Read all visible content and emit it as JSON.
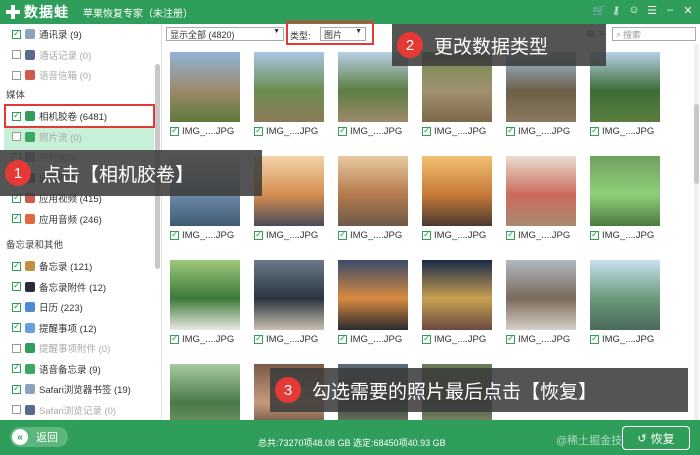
{
  "app": {
    "logo_text": "数据蛙",
    "title": "苹果恢复专家（未注册）",
    "titlebar_icons": [
      "cart-icon",
      "key-icon",
      "chat-icon",
      "menu-icon",
      "minimize-icon",
      "close-icon"
    ]
  },
  "sidebar": {
    "top_items": [
      {
        "label": "通讯录 (9)",
        "checked": true,
        "dim": false
      },
      {
        "label": "通话记录 (0)",
        "checked": false,
        "dim": true
      },
      {
        "label": "语音信箱 (0)",
        "checked": false,
        "dim": true
      }
    ],
    "media_title": "媒体",
    "media_items": [
      {
        "label": "相机胶卷 (6481)",
        "checked": true,
        "active": true,
        "dim": false
      },
      {
        "label": "照片流 (0)",
        "checked": false,
        "dim": true
      },
      {
        "label": "照片图库",
        "checked": false,
        "dim": true
      },
      {
        "label": "应用照片",
        "checked": true,
        "dim": false
      },
      {
        "label": "应用视频 (415)",
        "checked": true,
        "dim": false
      },
      {
        "label": "应用音频 (246)",
        "checked": true,
        "dim": false
      }
    ],
    "memo_title": "备忘录和其他",
    "memo_items": [
      {
        "label": "备忘录 (121)",
        "checked": true,
        "dim": false
      },
      {
        "label": "备忘录附件 (12)",
        "checked": true,
        "dim": false
      },
      {
        "label": "日历 (223)",
        "checked": true,
        "dim": false
      },
      {
        "label": "提醒事项 (12)",
        "checked": true,
        "dim": false
      },
      {
        "label": "提醒事项附件 (0)",
        "checked": false,
        "dim": true
      },
      {
        "label": "语音备忘录 (9)",
        "checked": true,
        "dim": false
      },
      {
        "label": "Safari浏览器书签 (19)",
        "checked": true,
        "dim": false
      },
      {
        "label": "Safari浏览记录 (0)",
        "checked": false,
        "dim": true
      }
    ]
  },
  "toolbar": {
    "filter_value": "显示全部 (4820)",
    "type_label": "类型:",
    "type_value": "图片",
    "search_placeholder": "搜索"
  },
  "grid": {
    "caption": "IMG_....JPG",
    "tiles": [
      {
        "colors": [
          "#8fb3d8",
          "#9b8a6a",
          "#5f7a3c"
        ]
      },
      {
        "colors": [
          "#a9c6e6",
          "#6b8e4e",
          "#8c7a5a"
        ]
      },
      {
        "colors": [
          "#b7cfe4",
          "#5d7d42",
          "#9c8a6a"
        ]
      },
      {
        "colors": [
          "#6f8d4f",
          "#a09070",
          "#7f6a4a"
        ]
      },
      {
        "colors": [
          "#9ec0dc",
          "#6d6048",
          "#8a7860"
        ]
      },
      {
        "colors": [
          "#b5d0e8",
          "#3d6e36",
          "#5b7e40"
        ]
      },
      {
        "colors": [
          "#dfe6ee",
          "#6e8ca8",
          "#3f5a74"
        ]
      },
      {
        "colors": [
          "#f3d2a8",
          "#d58e50",
          "#4a4a58"
        ]
      },
      {
        "colors": [
          "#e8c9a0",
          "#b47a4e",
          "#6d5a4a"
        ]
      },
      {
        "colors": [
          "#f0c070",
          "#c87a38",
          "#4a3a30"
        ]
      },
      {
        "colors": [
          "#e9ddd0",
          "#cc6a5a",
          "#a88a70"
        ]
      },
      {
        "colors": [
          "#6fa060",
          "#8ecf7a",
          "#4b7a40"
        ]
      },
      {
        "colors": [
          "#9ec87a",
          "#3b7a3a",
          "#e8e8e0"
        ]
      },
      {
        "colors": [
          "#6a7a8a",
          "#2a3440",
          "#c8c0b0"
        ]
      },
      {
        "colors": [
          "#3a4a6a",
          "#d88a40",
          "#2a2a30"
        ]
      },
      {
        "colors": [
          "#1a2a4a",
          "#c8a050",
          "#6a4a40"
        ]
      },
      {
        "colors": [
          "#b0b8c0",
          "#7a6a5a",
          "#d8d0c8"
        ]
      },
      {
        "colors": [
          "#c8e0f0",
          "#6a9a7a",
          "#4a6a5a"
        ]
      },
      {
        "colors": [
          "#a8c8a0",
          "#4a7a4a",
          "#7a9a6a"
        ]
      },
      {
        "colors": [
          "#7a5a4a",
          "#c89a7a",
          "#4a3a30"
        ]
      },
      {
        "colors": [
          "#5a6a7a",
          "#3a4a3a",
          "#8a8a7a"
        ]
      },
      {
        "colors": [
          "#6a7a5a",
          "#4a5a3a",
          "#9aa08a"
        ]
      }
    ]
  },
  "annotations": {
    "step1_num": "1",
    "step1_text": "点击【相机胶卷】",
    "step2_num": "2",
    "step2_text": "更改数据类型",
    "step3_num": "3",
    "step3_text": "勾选需要的照片最后点击【恢复】"
  },
  "bottom": {
    "back_label": "返回",
    "totals": "总共:73270项48.08 GB 选定:68450项40.93 GB",
    "watermark": "@稀土掘金技术社区",
    "recover_label": "恢复"
  },
  "colors": {
    "brand": "#2f9e5a",
    "highlight": "#e53935",
    "active_row": "#c8efd8"
  }
}
